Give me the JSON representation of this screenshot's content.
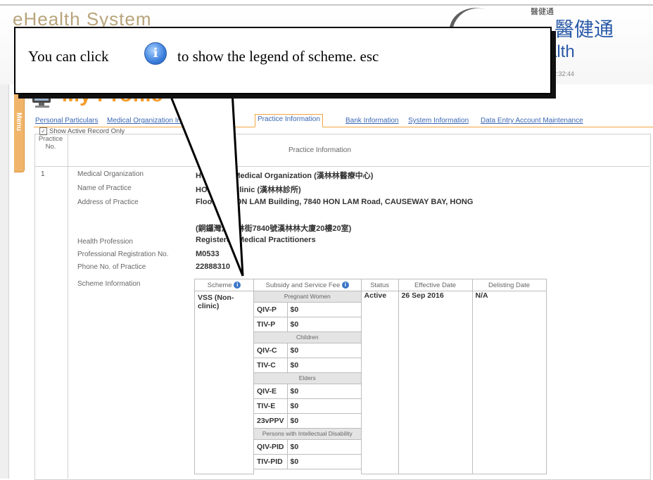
{
  "header": {
    "app_title": "eHealth System",
    "brand_cn_small": "醫健通",
    "brand_cn_big": "醫健通",
    "brand_en": "alth",
    "time": "2:32:44"
  },
  "side_menu": {
    "label": "Menu"
  },
  "page": {
    "title": "My Profile"
  },
  "tabs": [
    {
      "label": "Personal Particulars"
    },
    {
      "label": "Medical Organization Information"
    },
    {
      "label": "Practice Information"
    },
    {
      "label": "Bank Information"
    },
    {
      "label": "System Information"
    },
    {
      "label": "Data Entry Account Maintenance"
    }
  ],
  "practice_table": {
    "show_active_label": "Show Active Record Only",
    "col_practice_no": "Practice No.",
    "col_practice_info": "Practice Information",
    "row_no": "1",
    "labels": {
      "medical_org": "Medical Organization",
      "name_of_practice": "Name of Practice",
      "address": "Address of Practice",
      "health_profession": "Health Profession",
      "registration_no": "Professional Registration No.",
      "phone": "Phone No. of Practice",
      "scheme_info": "Scheme Information"
    },
    "values": {
      "medical_org": "HON LAM Medical Organization (漢林林醫療中心)",
      "name_of_practice": "HON LAM Clinic (漢林林診所)",
      "address_en": "Floor 20, HON LAM Building, 7840 HON LAM Road, CAUSEWAY BAY, HONG",
      "address_cn": "(銅鑼灣漢林林街7840號漢林林大廈20樓20室)",
      "health_profession": "Registered Medical Practitioners",
      "registration_no": "M0533",
      "phone": "22888310"
    }
  },
  "scheme_table": {
    "headers": {
      "scheme": "Scheme",
      "subsidy": "Subsidy and Service Fee",
      "status": "Status",
      "effective": "Effective Date",
      "delisting": "Delisting Date"
    },
    "scheme_name": "VSS (Non-clinic)",
    "status": "Active",
    "effective_date": "26 Sep 2016",
    "delisting_date": "N/A",
    "groups": {
      "g1": "Pregnant Women",
      "g2": "Children",
      "g3": "Elders",
      "g4": "Persons with Intellectual Disability"
    },
    "rows": {
      "r1": {
        "sub": "QIV-P",
        "fee": "$0"
      },
      "r2": {
        "sub": "TIV-P",
        "fee": "$0"
      },
      "r3": {
        "sub": "QIV-C",
        "fee": "$0"
      },
      "r4": {
        "sub": "TIV-C",
        "fee": "$0"
      },
      "r5": {
        "sub": "QIV-E",
        "fee": "$0"
      },
      "r6": {
        "sub": "TIV-E",
        "fee": "$0"
      },
      "r7": {
        "sub": "23vPPV",
        "fee": "$0"
      },
      "r8": {
        "sub": "QIV-PID",
        "fee": "$0"
      },
      "r9": {
        "sub": "TIV-PID",
        "fee": "$0"
      }
    }
  },
  "callout": {
    "text_before": "You can click",
    "icon": "info-icon",
    "text_after": "to show the legend of scheme. esc"
  }
}
